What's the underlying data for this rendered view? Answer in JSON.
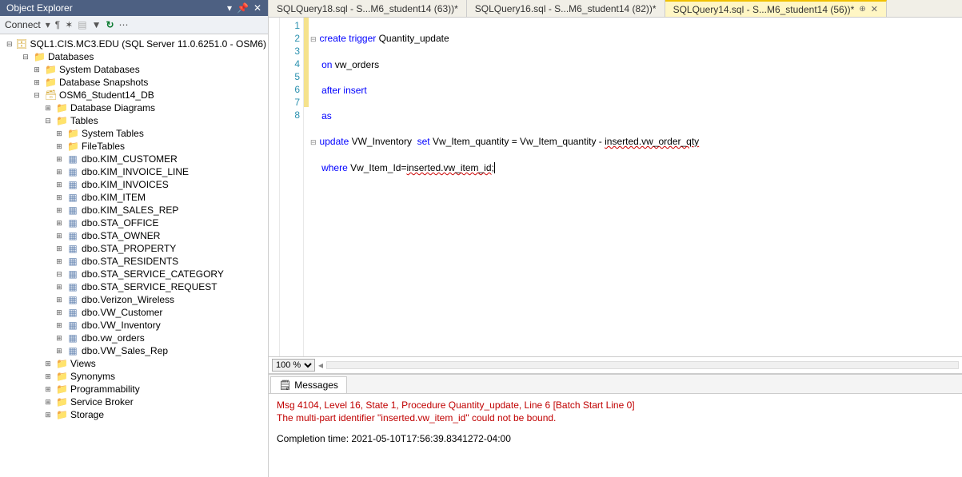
{
  "explorer": {
    "title": "Object Explorer",
    "connect": "Connect",
    "server": "SQL1.CIS.MC3.EDU (SQL Server 11.0.6251.0 - OSM6)",
    "databasesLabel": "Databases",
    "systemDatabases": "System Databases",
    "databaseSnapshots": "Database Snapshots",
    "studentDb": "OSM6_Student14_DB",
    "databaseDiagrams": "Database Diagrams",
    "tablesLabel": "Tables",
    "systemTables": "System Tables",
    "fileTables": "FileTables",
    "tables": [
      "dbo.KIM_CUSTOMER",
      "dbo.KIM_INVOICE_LINE",
      "dbo.KIM_INVOICES",
      "dbo.KIM_ITEM",
      "dbo.KIM_SALES_REP",
      "dbo.STA_OFFICE",
      "dbo.STA_OWNER",
      "dbo.STA_PROPERTY",
      "dbo.STA_RESIDENTS",
      "dbo.STA_SERVICE_CATEGORY",
      "dbo.STA_SERVICE_REQUEST",
      "dbo.Verizon_Wireless",
      "dbo.VW_Customer",
      "dbo.VW_Inventory",
      "dbo.vw_orders",
      "dbo.VW_Sales_Rep"
    ],
    "folders": [
      "Views",
      "Synonyms",
      "Programmability",
      "Service Broker",
      "Storage"
    ]
  },
  "tabs": [
    {
      "label": "SQLQuery18.sql - S...M6_student14 (63))*",
      "active": false
    },
    {
      "label": "SQLQuery16.sql - S...M6_student14 (82))*",
      "active": false
    },
    {
      "label": "SQLQuery14.sql - S...M6_student14 (56))*",
      "active": true
    }
  ],
  "editor": {
    "lines": [
      1,
      2,
      3,
      4,
      5,
      6,
      7,
      8
    ],
    "code": {
      "l1a": "create",
      "l1b": " trigger",
      "l1c": " Quantity_update",
      "l2a": "on",
      "l2b": " vw_orders",
      "l3a": "after",
      "l3b": " insert",
      "l4": "as",
      "l5a": "update",
      "l5b": " VW_Inventory  ",
      "l5c": "set",
      "l5d": " Vw_Item_quantity ",
      "l5e": "=",
      "l5f": " Vw_Item_quantity ",
      "l5g": "-",
      "l5h": " ",
      "l5i": "inserted.vw_order_qty",
      "l6a": "where",
      "l6b": " Vw_Item_Id",
      "l6c": "=",
      "l6d": "inserted.vw_item_id",
      "l6e": ";"
    }
  },
  "zoom": "100 %",
  "messages": {
    "tabLabel": "Messages",
    "line1": "Msg 4104, Level 16, State 1, Procedure Quantity_update, Line 6 [Batch Start Line 0]",
    "line2": "The multi-part identifier \"inserted.vw_item_id\" could not be bound.",
    "completion": "Completion time: 2021-05-10T17:56:39.8341272-04:00"
  }
}
